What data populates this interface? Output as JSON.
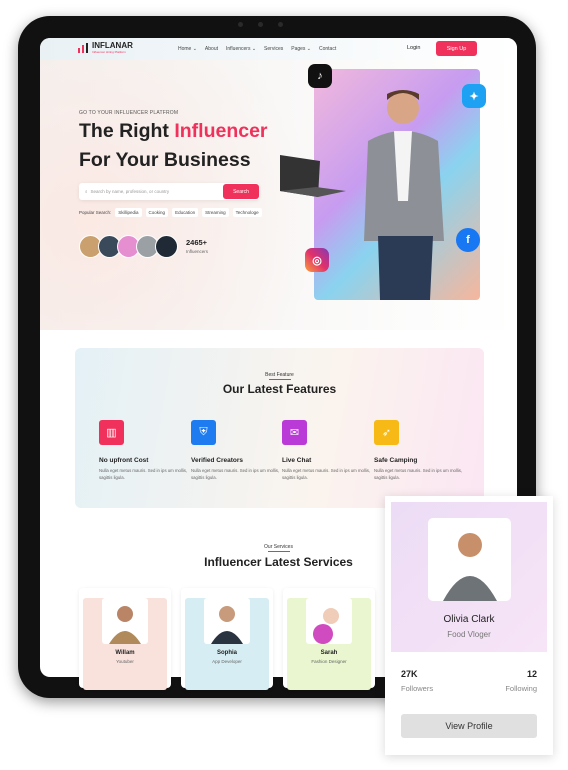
{
  "nav": {
    "brand": "INFLANAR",
    "tagline": "Influencer Hiring Platform",
    "items": [
      "Home ⌄",
      "About",
      "Influencers ⌄",
      "Services",
      "Pages ⌄",
      "Contact"
    ],
    "login": "Login",
    "signup": "Sign Up"
  },
  "hero": {
    "eyebrow": "GO TO YOUR INFLUENCER PLATFROM",
    "title_1a": "The Right ",
    "title_1b": "Influencer",
    "title_2": "For Your Business",
    "search_placeholder": "Search by name, profession, or country",
    "search_button": "Search",
    "popular_label": "Popular Search:",
    "tags": [
      "Skillipedia",
      "Cooking",
      "Education",
      "Streaming",
      "Technologe"
    ],
    "count": "2465+",
    "count_label": "Influencers"
  },
  "features": {
    "eyebrow": "Best Feature",
    "title": "Our Latest Features",
    "items": [
      {
        "title": "No upfront Cost",
        "desc": "Nulla eget metus mauris. Sed in ips um mollis, sagittis ligula.",
        "color": "#f0315b",
        "icon": "chart-icon"
      },
      {
        "title": "Verified Creators",
        "desc": "Nulla eget metus mauris. Sed in ips um mollis, sagittis ligula.",
        "color": "#1e7cf0",
        "icon": "shield-icon"
      },
      {
        "title": "Live Chat",
        "desc": "Nulla eget metus mauris. Sed in ips um mollis, sagittis ligula.",
        "color": "#b93ad6",
        "icon": "chat-icon"
      },
      {
        "title": "Safe Camping",
        "desc": "Nulla eget metus mauris. Sed in ips um mollis, sagittis ligula.",
        "color": "#f7b916",
        "icon": "rocket-icon"
      }
    ]
  },
  "services": {
    "eyebrow": "Our Services",
    "title": "Influencer Latest Services",
    "items": [
      {
        "name": "Willam",
        "role": "Youtuber"
      },
      {
        "name": "Sophia",
        "role": "App Developer"
      },
      {
        "name": "Sarah",
        "role": "Fashion Designer"
      }
    ]
  },
  "profile": {
    "name": "Olivia Clark",
    "role": "Food Vloger",
    "followers": "27K",
    "followers_label": "Followers",
    "following": "12",
    "following_label": "Following",
    "button": "View Profile"
  }
}
